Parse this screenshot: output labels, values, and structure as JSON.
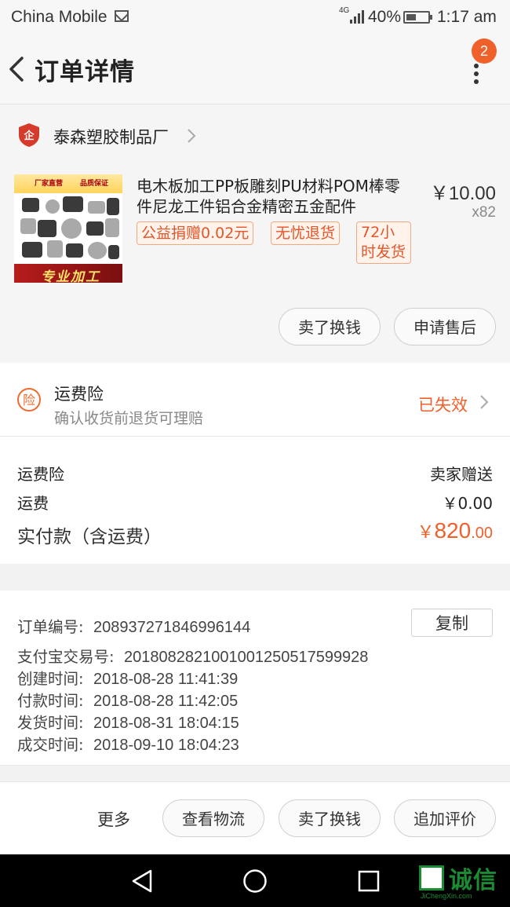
{
  "status_bar": {
    "carrier": "China Mobile",
    "network_type": "4G",
    "battery_percent": "40%",
    "time": "1:17 am"
  },
  "header": {
    "title": "订单详情",
    "badge_count": "2"
  },
  "shop": {
    "name": "泰森塑胶制品厂"
  },
  "product": {
    "title": "电木板加工PP板雕刻PU材料POM棒零件尼龙工件铝合金精密五金配件",
    "price": "￥10.00",
    "quantity": "x82",
    "tags": [
      "公益捐赠0.02元",
      "无忧退货",
      "72小时发货"
    ],
    "thumbnail": {
      "banner_left": "厂家直营",
      "banner_right": "品质保证",
      "footer": "专业加工"
    },
    "buttons": {
      "sell": "卖了换钱",
      "after_sales": "申请售后"
    }
  },
  "insurance": {
    "title": "运费险",
    "subtitle": "确认收货前退货可理赔",
    "status": "已失效"
  },
  "fees": {
    "rows": [
      {
        "label": "运费险",
        "value": "卖家赠送"
      },
      {
        "label": "运费",
        "value": "￥0.00"
      }
    ],
    "total_label": "实付款（含运费）",
    "total_currency": "￥",
    "total_integer": "820",
    "total_decimal": ".00"
  },
  "order_info": {
    "copy_label": "复制",
    "lines": [
      {
        "label": "订单编号:",
        "value": "208937271846996144"
      },
      {
        "label": "支付宝交易号:",
        "value": "2018082821001001250517599928"
      },
      {
        "label": "创建时间:",
        "value": "2018-08-28 11:41:39"
      },
      {
        "label": "付款时间:",
        "value": "2018-08-28 11:42:05"
      },
      {
        "label": "发货时间:",
        "value": "2018-08-31 18:04:15"
      },
      {
        "label": "成交时间:",
        "value": "2018-09-10 18:04:23"
      }
    ]
  },
  "actions": {
    "more": "更多",
    "logistics": "查看物流",
    "sell": "卖了换钱",
    "review": "追加评价"
  },
  "watermark": {
    "text": "诚信",
    "domain": "JiChengXin.com"
  },
  "colors": {
    "accent": "#f0602b",
    "tag_border": "#f0a883",
    "watermark": "#1a8a33"
  }
}
